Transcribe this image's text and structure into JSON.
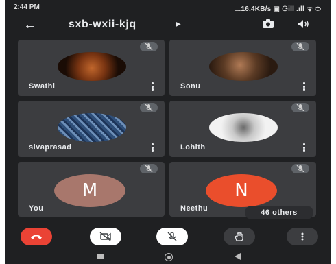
{
  "status_bar": {
    "time": "2:44 PM",
    "right": "...16.4KB/s ▣ ⚆ill .ıll ᯤ ⬭"
  },
  "meeting": {
    "code": "sxb-wxii-kjq"
  },
  "participants": [
    {
      "name": "Swathi",
      "avatar": "photo-lion",
      "muted": true
    },
    {
      "name": "Sonu",
      "avatar": "photo-man",
      "muted": true
    },
    {
      "name": "sivaprasad",
      "avatar": "photo-numbers",
      "muted": true
    },
    {
      "name": "Lohith",
      "avatar": "photo-person-street",
      "muted": true
    },
    {
      "name": "You",
      "avatar_letter": "M",
      "avatar_color": "#a8776c",
      "muted": true
    },
    {
      "name": "Neethu",
      "avatar_letter": "N",
      "avatar_color": "#ea4e2c",
      "muted": true
    }
  ],
  "others_label": "46 others",
  "controls": [
    "end-call-icon",
    "camera-off-icon",
    "mic-off-icon",
    "raise-hand-icon",
    "more-vert-icon"
  ],
  "colors": {
    "background": "#1f2022",
    "tile": "#3c3d40",
    "end_call": "#ea4335"
  }
}
